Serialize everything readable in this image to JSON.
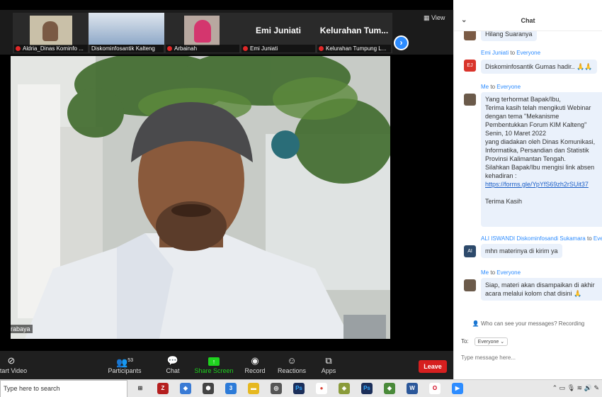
{
  "gallery": {
    "tiles": [
      {
        "name": "Aldria_Dinas Kominfo ..."
      },
      {
        "name": "Diskominfosantik Kalteng"
      },
      {
        "name": "Arbainah"
      },
      {
        "name": "Emi Juniati",
        "big": "Emi Juniati"
      },
      {
        "name": "Kelurahan Tumpung L...",
        "big": "Kelurahan Tum..."
      }
    ],
    "view_label": "View"
  },
  "video": {
    "speaker_label": "rabaya"
  },
  "controls": {
    "start_video": "Start Video",
    "participants": "Participants",
    "participants_count": "53",
    "chat": "Chat",
    "share_screen": "Share Screen",
    "record": "Record",
    "reactions": "Reactions",
    "apps": "Apps",
    "leave": "Leave"
  },
  "chat": {
    "title": "Chat",
    "messages": [
      {
        "text": "Hilang Suaranya"
      },
      {
        "from": "Emi Juniati",
        "to": "Everyone",
        "initials": "EJ",
        "text": "Diskominfosantik Gumas hadir.."
      },
      {
        "from": "Me",
        "to": "Everyone",
        "text": "Yang terhormat Bapak/Ibu,\nTerima kasih telah mengikuti Webinar\ndengan tema \"Mekanisme\nPembentukkan Forum KIM Kalteng\"\nSenin, 10 Maret 2022\nyang diadakan oleh Dinas Komunikasi,\nInformatika, Persandian dan Statistik\nProvinsi Kalimantan Tengah.\nSilahkan Bapak/Ibu mengisi link absen\nkehadiran :",
        "link": "https://forms.gle/YpYfS69zh2rSUit37",
        "closing": "Terima Kasih"
      },
      {
        "from": "ALI ISWANDI Diskominfosandi Sukamara",
        "to": "Everyone",
        "initials": "AI",
        "text": "mhn materinya di kirim ya"
      },
      {
        "from": "Me",
        "to": "Everyone",
        "text": "Siap, materi akan disampaikan di akhir\nacara melalui kolom chat disini"
      }
    ],
    "to_label": "To:",
    "to_value": "Everyone",
    "placeholder": "Type message here...",
    "who_can_see": "Who can see your messages? Recording"
  },
  "taskbar": {
    "search": "Type here to search"
  },
  "colors": {
    "accent": "#2d8cff",
    "leave": "#d61f1f",
    "share": "#1fd31f"
  }
}
